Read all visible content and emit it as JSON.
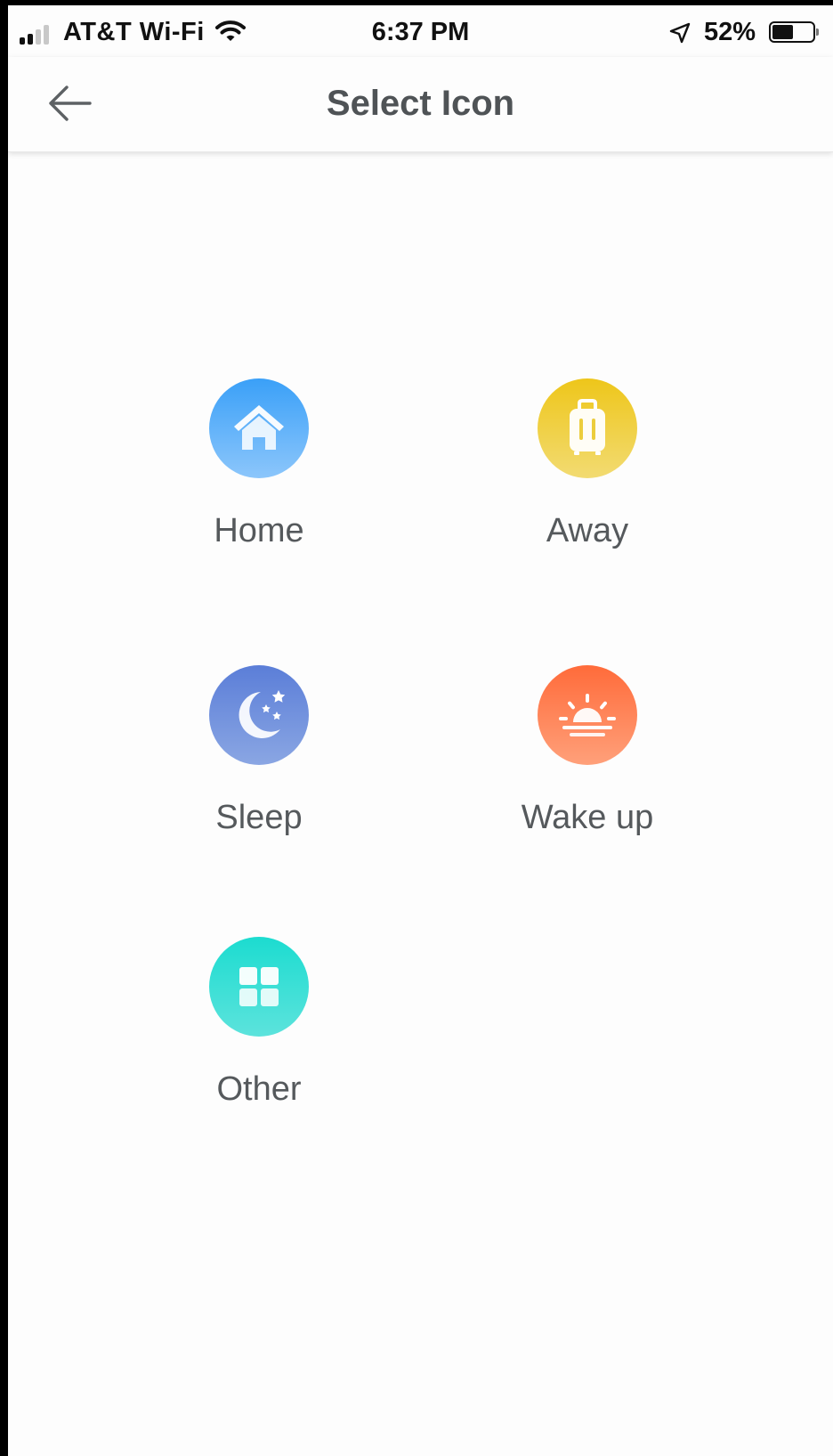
{
  "status_bar": {
    "carrier": "AT&T Wi-Fi",
    "time": "6:37 PM",
    "battery_percent": "52%",
    "battery_level": 0.52,
    "signal_bars": 2,
    "icons": [
      "signal-icon",
      "wifi-icon",
      "location-arrow-icon",
      "battery-icon"
    ]
  },
  "header": {
    "title": "Select Icon",
    "back_icon": "arrow-left-icon"
  },
  "options": [
    {
      "id": "home",
      "label": "Home",
      "icon": "home-icon",
      "gradient": [
        "#3aa0f8",
        "#8cc6fb"
      ]
    },
    {
      "id": "away",
      "label": "Away",
      "icon": "suitcase-icon",
      "gradient": [
        "#eec61a",
        "#f2db72"
      ]
    },
    {
      "id": "sleep",
      "label": "Sleep",
      "icon": "moon-stars-icon",
      "gradient": [
        "#5b7ed8",
        "#8aa6e3"
      ]
    },
    {
      "id": "wake-up",
      "label": "Wake up",
      "icon": "sunrise-icon",
      "gradient": [
        "#ff6b3a",
        "#ffa07a"
      ]
    },
    {
      "id": "other",
      "label": "Other",
      "icon": "grid-icon",
      "gradient": [
        "#1cdcd0",
        "#5ce3dc"
      ]
    }
  ]
}
